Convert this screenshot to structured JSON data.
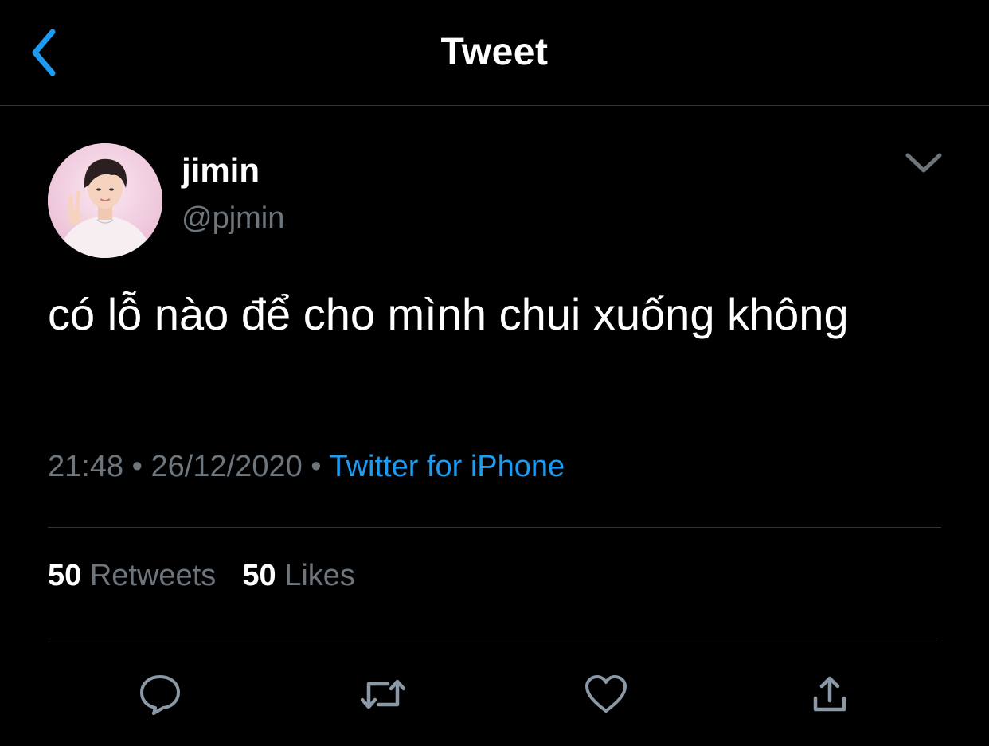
{
  "header": {
    "title": "Tweet",
    "back_icon": "chevron-left-icon",
    "accent_color": "#1d9bf0"
  },
  "tweet": {
    "author": {
      "name": "jimin",
      "handle": "@pjmin",
      "avatar": "profile-photo"
    },
    "text": "có lỗ nào để cho mình chui xuống không",
    "time": "21:48",
    "date": "26/12/2020",
    "separator": "•",
    "source": "Twitter for iPhone",
    "more_icon": "chevron-down-icon"
  },
  "stats": {
    "retweets_count": "50",
    "retweets_label": "Retweets",
    "likes_count": "50",
    "likes_label": "Likes"
  },
  "actions": [
    {
      "icon": "reply-icon"
    },
    {
      "icon": "retweet-icon"
    },
    {
      "icon": "like-icon"
    },
    {
      "icon": "share-icon"
    }
  ],
  "colors": {
    "background": "#000000",
    "text": "#ffffff",
    "secondary": "#6e767d",
    "divider": "#2f3336",
    "link": "#1d9bf0"
  }
}
